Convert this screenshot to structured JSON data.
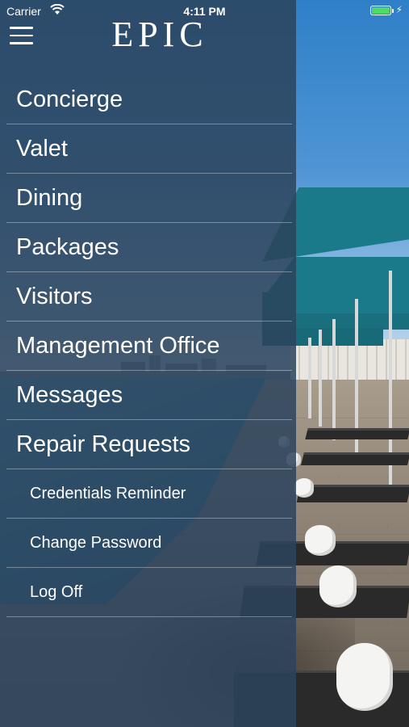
{
  "status_bar": {
    "carrier": "Carrier",
    "time": "4:11 PM",
    "wifi_icon": "wifi-icon",
    "battery_icon": "battery-icon",
    "battery_level": 1.0,
    "charging_icon": "bolt-icon",
    "battery_color": "#4cd964"
  },
  "header": {
    "menu_icon": "hamburger-icon",
    "logo_text": "EPIC"
  },
  "menu": {
    "items": [
      {
        "label": "Concierge"
      },
      {
        "label": "Valet"
      },
      {
        "label": "Dining"
      },
      {
        "label": "Packages"
      },
      {
        "label": "Visitors"
      },
      {
        "label": "Management Office"
      },
      {
        "label": "Messages"
      },
      {
        "label": "Repair Requests"
      }
    ],
    "secondary_items": [
      {
        "label": "Credentials Reminder"
      },
      {
        "label": "Change Password"
      },
      {
        "label": "Log Off"
      }
    ]
  },
  "colors": {
    "panel": "#2c445c",
    "text": "#ffffff"
  }
}
